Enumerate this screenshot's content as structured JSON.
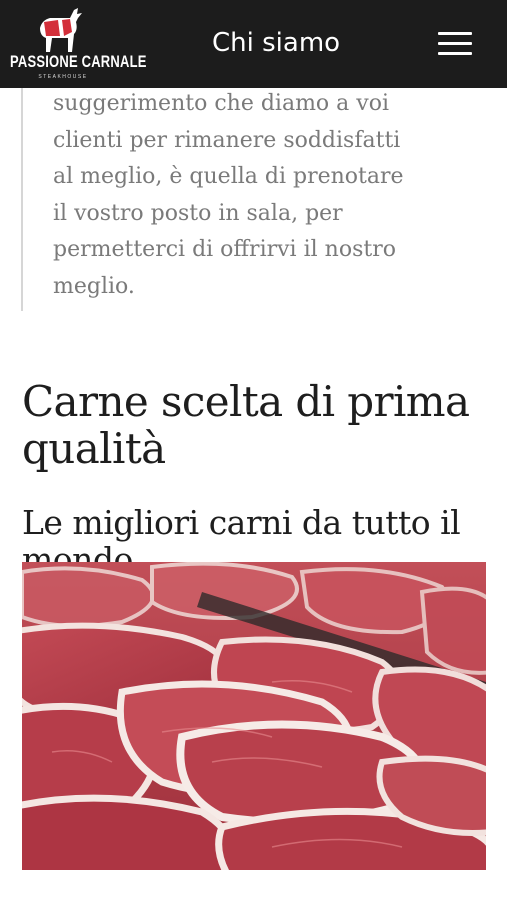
{
  "header": {
    "logo_text": "PASSIONE CARNALE",
    "logo_subtext": "STEAKHOUSE",
    "title": "Chi siamo",
    "menu_icon": "hamburger-menu-icon"
  },
  "quote": {
    "lines": [
      "suggerimento che diamo a voi",
      "clienti per rimanere soddisfatti",
      "al meglio, è quella di prenotare",
      "il vostro posto in sala, per",
      "permetterci di offrirvi il nostro",
      "meglio."
    ]
  },
  "section": {
    "heading": "Carne scelta di prima qualità",
    "subheading": "Le migliori carni da tutto il mondo"
  },
  "colors": {
    "header_bg": "#1c1c1c",
    "meat_red": "#b8404c",
    "text_dark": "#1e1e1e",
    "text_muted": "#7a7a7a"
  }
}
